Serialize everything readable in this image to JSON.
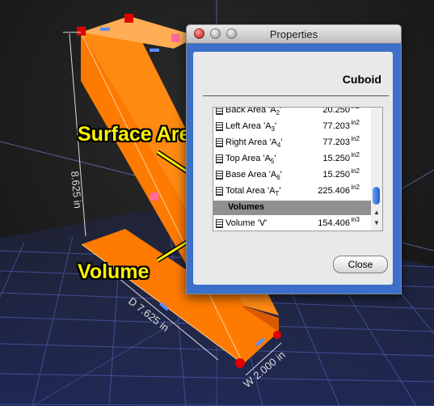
{
  "window": {
    "title": "Properties",
    "heading": "Cuboid",
    "close_label": "Close"
  },
  "properties": [
    {
      "label": "Back Area 'A",
      "sub": "2",
      "suffix": "'",
      "value": "20.250",
      "unit": "in2"
    },
    {
      "label": "Left Area 'A",
      "sub": "3",
      "suffix": "'",
      "value": "77.203",
      "unit": "in2"
    },
    {
      "label": "Right Area 'A",
      "sub": "4",
      "suffix": "'",
      "value": "77.203",
      "unit": "in2"
    },
    {
      "label": "Top Area 'A",
      "sub": "5",
      "suffix": "'",
      "value": "15.250",
      "unit": "in2"
    },
    {
      "label": "Base Area 'A",
      "sub": "6",
      "suffix": "'",
      "value": "15.250",
      "unit": "in2"
    },
    {
      "label": "Total Area 'A",
      "sub": "T",
      "suffix": "'",
      "value": "225.406",
      "unit": "in2"
    }
  ],
  "volumes_section": "Volumes",
  "volume_row": {
    "label": "Volume 'V'",
    "value": "154.406",
    "unit": "in3"
  },
  "callouts": {
    "surface_area": "Surface Area",
    "volume": "Volume"
  },
  "dimensions": {
    "height": "8.625 in",
    "depth": "D 7.625 in",
    "width": "W 2.000 in"
  },
  "colors": {
    "cuboid_front": "#ff7a00",
    "cuboid_top": "#ffa040",
    "grid": "#3f4fa0",
    "window_frame": "#3b6fc9",
    "callout": "#fff200"
  }
}
